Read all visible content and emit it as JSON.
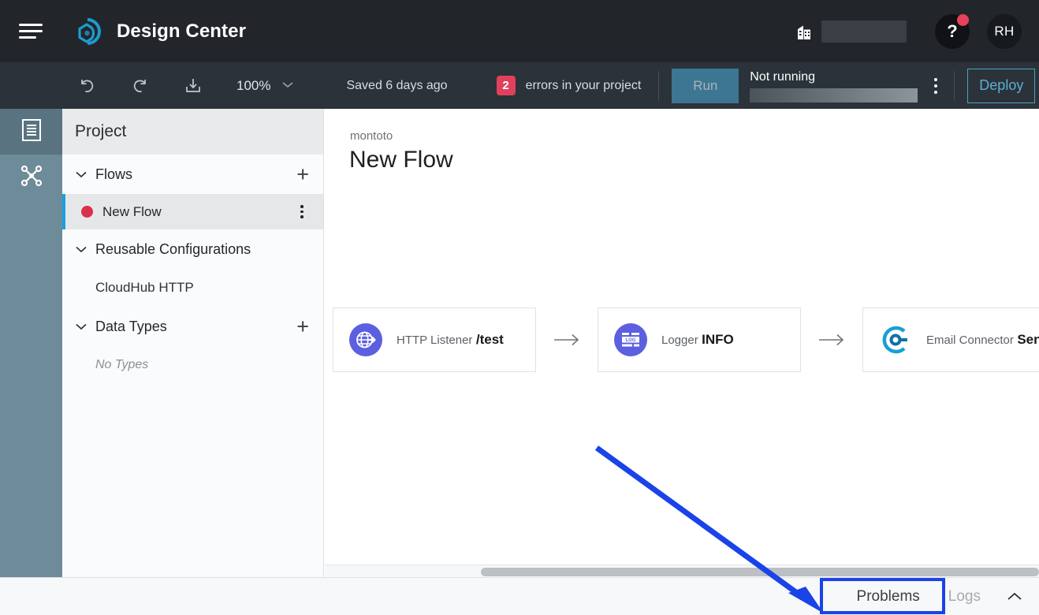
{
  "header": {
    "menu_icon": "hamburger-icon",
    "logo_icon": "anypoint-logo-icon",
    "title": "Design Center",
    "org_icon": "organization-icon",
    "org_name_redacted": "",
    "help_label": "?",
    "avatar_initials": "RH"
  },
  "toolbar": {
    "undo_icon": "undo-icon",
    "redo_icon": "redo-icon",
    "import_icon": "import-icon",
    "zoom_level": "100%",
    "zoom_caret_icon": "chevron-down-icon",
    "saved_status": "Saved 6 days ago",
    "error_count": "2",
    "error_text": "errors in your project",
    "run_label": "Run",
    "run_status_label": "Not running",
    "run_status_redacted": "",
    "more_icon": "kebab-menu-icon",
    "deploy_label": "Deploy"
  },
  "rail": {
    "items": [
      {
        "icon": "project-document-icon",
        "name": "project-explorer",
        "active": true
      },
      {
        "icon": "api-nodes-icon",
        "name": "api-sync",
        "active": false
      }
    ]
  },
  "sidebar": {
    "title": "Project",
    "sections": [
      {
        "label": "Flows",
        "caret": "chevron-down-icon",
        "add": "+"
      },
      {
        "label": "Reusable Configurations",
        "caret": "chevron-down-icon",
        "add": ""
      },
      {
        "label": "Data Types",
        "caret": "chevron-down-icon",
        "add": "+"
      }
    ],
    "flow_item": {
      "label": "New Flow",
      "status_dot_color": "#d8304d",
      "menu_icon": "kebab-menu-icon"
    },
    "reusable_config_item": "CloudHub HTTP",
    "data_types_empty": "No Types"
  },
  "canvas": {
    "breadcrumb": "montoto",
    "flow_title": "New Flow",
    "cards": [
      {
        "icon": "http-listener-globe-icon",
        "kind": "HTTP Listener",
        "value": "/test",
        "icon_color": "#5b5fe0"
      },
      {
        "icon": "logger-icon",
        "kind": "Logger",
        "value": "INFO",
        "icon_color": "#5b5fe0"
      },
      {
        "icon": "email-connector-icon",
        "kind": "Email Connector",
        "value": "Send",
        "icon_color": "#17a0d4"
      }
    ],
    "connector_icon": "arrow-right-icon",
    "scrollbar": "horizontal-scrollbar"
  },
  "bottom_bar": {
    "tabs": [
      {
        "label": "Problems",
        "active": true
      },
      {
        "label": "Logs",
        "active": false
      }
    ],
    "collapse_icon": "chevron-up-icon"
  },
  "annotation": {
    "highlight_color": "#1a43e8",
    "highlight_target": "Problems",
    "arrow_icon": "pointer-arrow"
  }
}
